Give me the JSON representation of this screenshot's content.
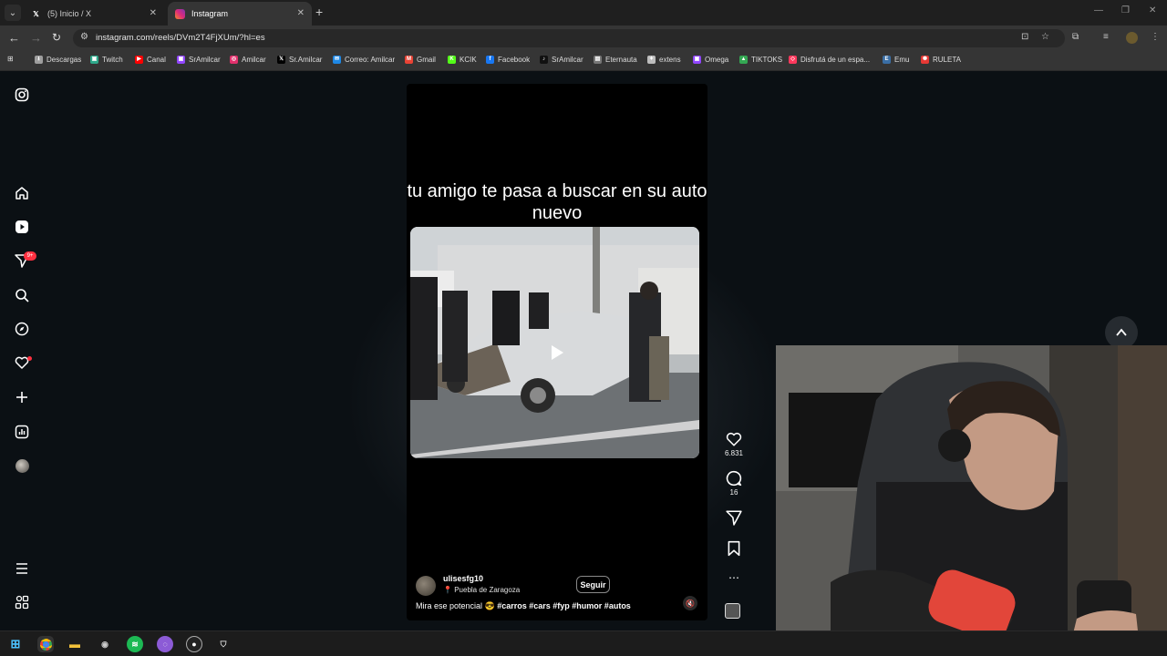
{
  "browser": {
    "tabs": [
      {
        "title": "(5) Inicio / X",
        "favicon": "x-icon",
        "active": false
      },
      {
        "title": "Instagram",
        "favicon": "instagram-icon",
        "active": true
      }
    ],
    "url": "instagram.com/reels/DVm2T4FjXUm/?hl=es",
    "bookmarks": [
      {
        "label": "Descargas",
        "icon": "download-icon",
        "color": "#9e9e9e"
      },
      {
        "label": "Twitch",
        "icon": "twitch-icon",
        "color": "#2ea88a"
      },
      {
        "label": "Canal",
        "icon": "youtube-icon",
        "color": "#ff0000"
      },
      {
        "label": "SrAmilcar",
        "icon": "twitch-icon",
        "color": "#9146ff"
      },
      {
        "label": "Amilcar",
        "icon": "instagram-icon",
        "color": "#e1306c"
      },
      {
        "label": "Sr.Amilcar",
        "icon": "x-icon",
        "color": "#000000"
      },
      {
        "label": "Correo: Amilcar",
        "icon": "mail-icon",
        "color": "#1e88e5"
      },
      {
        "label": "Gmail",
        "icon": "gmail-icon",
        "color": "#ea4335"
      },
      {
        "label": "KCIK",
        "icon": "kick-icon",
        "color": "#53fc18"
      },
      {
        "label": "Facebook",
        "icon": "facebook-icon",
        "color": "#1877f2"
      },
      {
        "label": "SrAmilcar",
        "icon": "tiktok-icon",
        "color": "#111111"
      },
      {
        "label": "Eternauta",
        "icon": "book-icon",
        "color": "#777777"
      },
      {
        "label": "extens",
        "icon": "puzzle-icon",
        "color": "#bdbdbd"
      },
      {
        "label": "Omega",
        "icon": "twitch-icon",
        "color": "#9146ff"
      },
      {
        "label": "TIKTOKS",
        "icon": "drive-icon",
        "color": "#34a853"
      },
      {
        "label": "Disfrutá de un espa...",
        "icon": "airbnb-icon",
        "color": "#ff385c"
      },
      {
        "label": "Emu",
        "icon": "emu-icon",
        "color": "#3a6ea5"
      },
      {
        "label": "RULETA",
        "icon": "wheel-icon",
        "color": "#e53935"
      }
    ]
  },
  "sidebar": {
    "notifications_badge": "9+"
  },
  "reel": {
    "overlay_text": "tu amigo te pasa a buscar en su auto nuevo",
    "username": "ulisesfg10",
    "location": "Puebla de Zaragoza",
    "follow_label": "Seguir",
    "caption_text": "Mira ese potencial 😎 ",
    "caption_tags": "#carros #cars #fyp #humor #autos",
    "likes": "6.831",
    "comments": "16"
  }
}
